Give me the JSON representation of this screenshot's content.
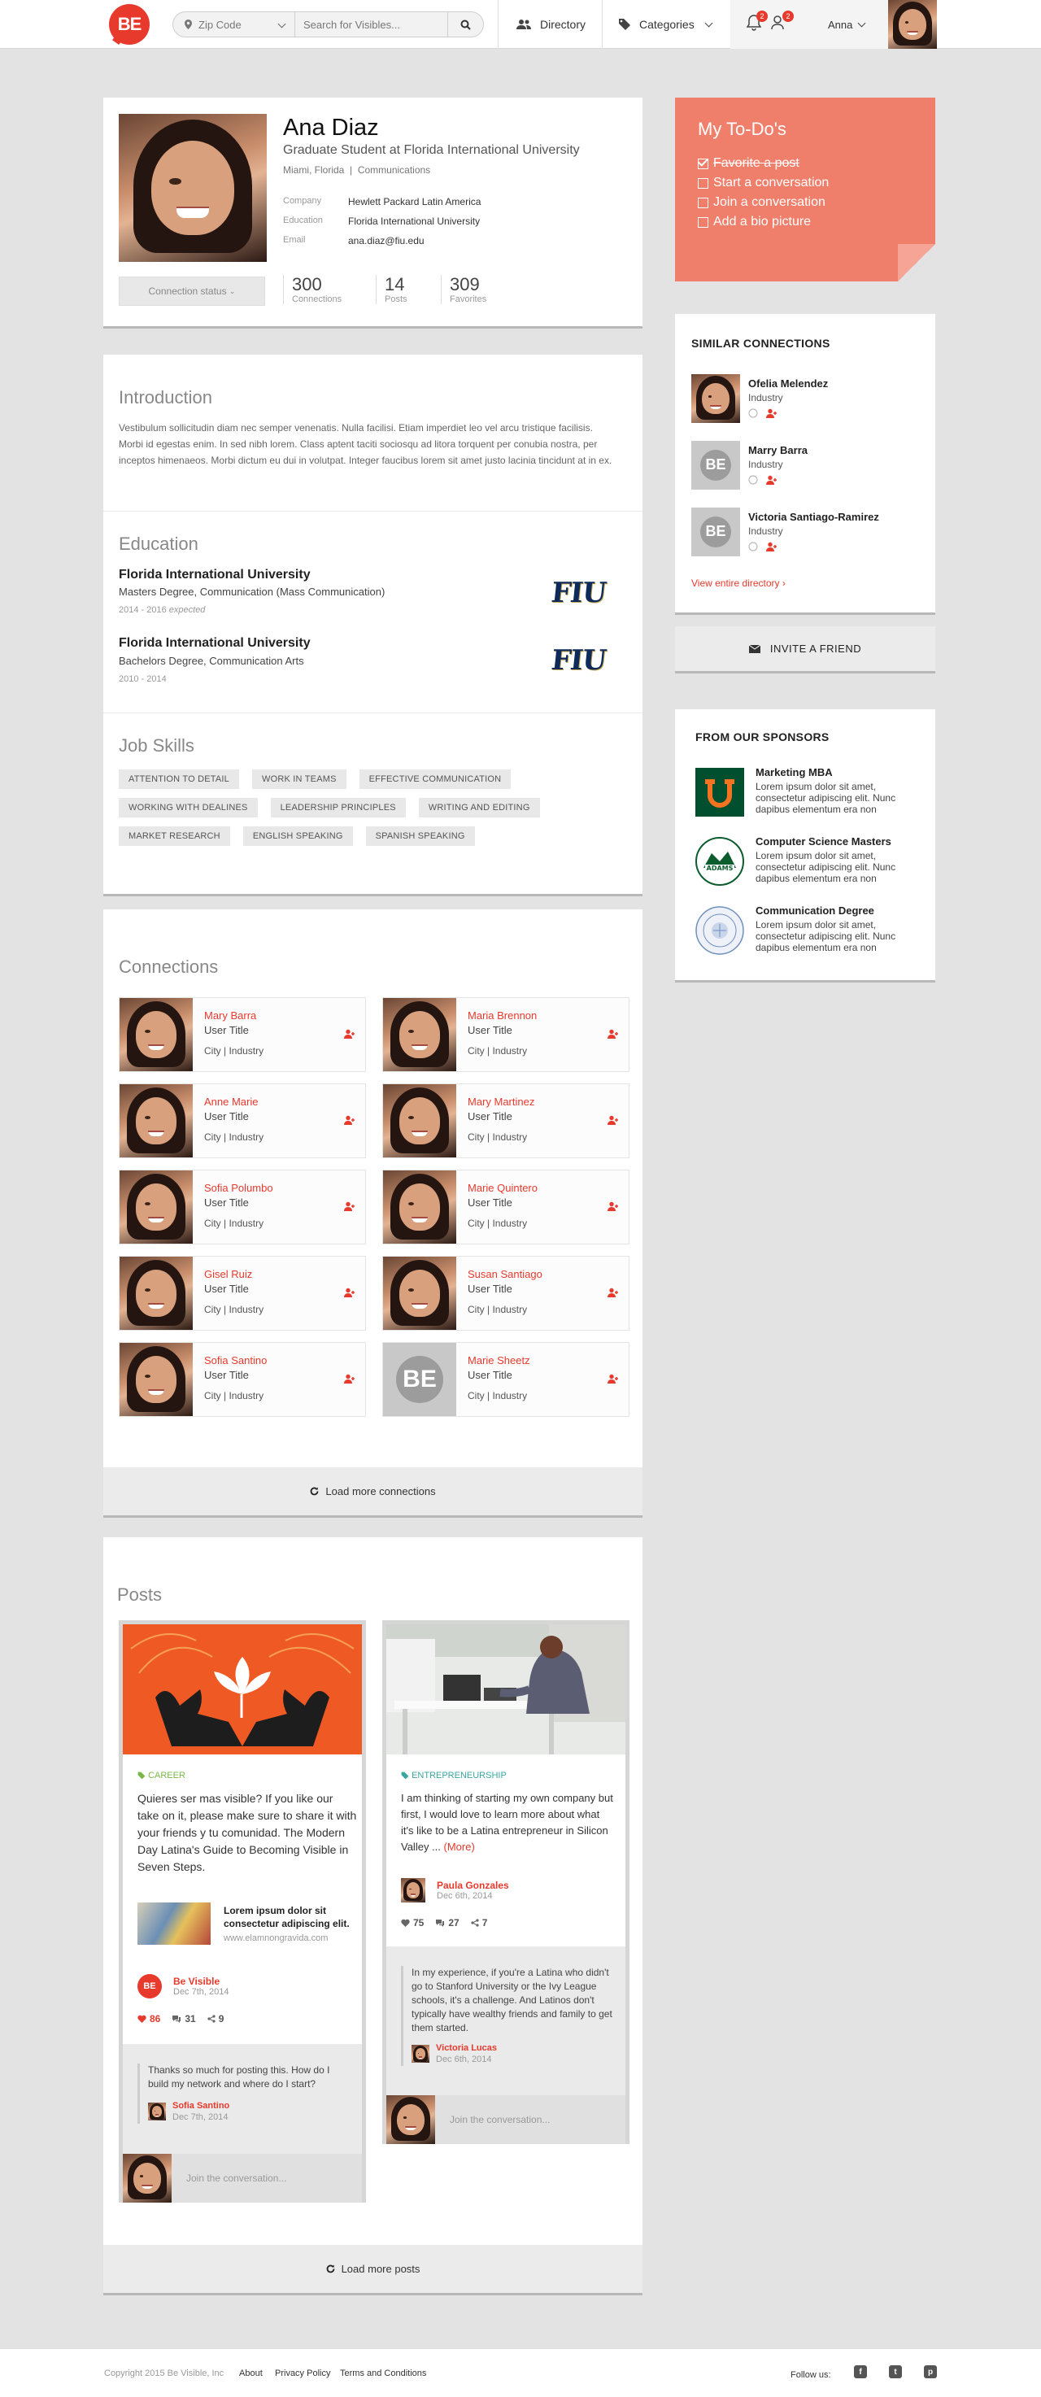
{
  "header": {
    "logo_text": "BE",
    "zip_label": "Zip Code",
    "search_placeholder": "Search for Visibles...",
    "nav_directory": "Directory",
    "nav_categories": "Categories",
    "notif_count": "2",
    "friend_count": "2",
    "user_name": "Anna"
  },
  "profile": {
    "name": "Ana Diaz",
    "title": "Graduate Student at Florida International University",
    "location": "Miami, Florida",
    "field": "Communications",
    "company_label": "Company",
    "company": "Hewlett Packard Latin America",
    "education_label": "Education",
    "education": "Florida International University",
    "email_label": "Email",
    "email": "ana.diaz@fiu.edu",
    "connection_status": "Connection status",
    "stats": [
      {
        "value": "300",
        "label": "Connections"
      },
      {
        "value": "14",
        "label": "Posts"
      },
      {
        "value": "309",
        "label": "Favorites"
      }
    ]
  },
  "intro": {
    "heading": "Introduction",
    "text": "Vestibulum sollicitudin diam nec semper venenatis. Nulla facilisi. Etiam imperdiet leo vel arcu tristique facilisis. Morbi id egestas enim. In sed nibh lorem. Class aptent taciti sociosqu ad litora torquent per conubia nostra, per inceptos himenaeos. Morbi dictum eu dui in volutpat. Integer faucibus lorem sit amet justo lacinia tincidunt at in ex."
  },
  "education": {
    "heading": "Education",
    "items": [
      {
        "school": "Florida International University",
        "degree": "Masters Degree, Communication (Mass Communication)",
        "years": "2014 - 2016",
        "note": "expected",
        "logo": "FIU"
      },
      {
        "school": "Florida International University",
        "degree": "Bachelors Degree, Communication Arts",
        "years": "2010 - 2014",
        "note": "",
        "logo": "FIU"
      }
    ]
  },
  "skills": {
    "heading": "Job Skills",
    "tags": [
      "ATTENTION TO DETAIL",
      "WORK IN TEAMS",
      "EFFECTIVE COMMUNICATION",
      "WORKING WITH DEALINES",
      "LEADERSHIP PRINCIPLES",
      "WRITING AND EDITING",
      "MARKET RESEARCH",
      "ENGLISH SPEAKING",
      "SPANISH SPEAKING"
    ]
  },
  "connections": {
    "heading": "Connections",
    "items": [
      {
        "name": "Mary Barra",
        "title": "User Title",
        "loc": "City | Industry"
      },
      {
        "name": "Maria Brennon",
        "title": "User Title",
        "loc": "City | Industry"
      },
      {
        "name": "Anne Marie",
        "title": "User Title",
        "loc": "City | Industry"
      },
      {
        "name": "Mary Martinez",
        "title": "User Title",
        "loc": "City | Industry"
      },
      {
        "name": "Sofia Polumbo",
        "title": "User Title",
        "loc": "City | Industry"
      },
      {
        "name": "Marie Quintero",
        "title": "User Title",
        "loc": "City | Industry"
      },
      {
        "name": "Gisel Ruiz",
        "title": "User Title",
        "loc": "City | Industry"
      },
      {
        "name": "Susan Santiago",
        "title": "User Title",
        "loc": "City | Industry"
      },
      {
        "name": "Sofia Santino",
        "title": "User Title",
        "loc": "City | Industry"
      },
      {
        "name": "Marie Sheetz",
        "title": "User Title",
        "loc": "City | Industry"
      }
    ],
    "load_more": "Load more connections"
  },
  "posts": {
    "heading": "Posts",
    "load_more": "Load more posts",
    "post1": {
      "category": "CAREER",
      "body": "Quieres ser mas visible? If you like our take on it, please make sure to share it with your friends y tu comunidad. The Modern Day Latina's Guide to Becoming Visible in Seven Steps.",
      "link_title": "Lorem ipsum dolor sit consectetur adipiscing elit.",
      "link_url": "www.elamnongravida.com",
      "author": "Be Visible",
      "date": "Dec 7th, 2014",
      "likes": "86",
      "comments": "31",
      "shares": "9",
      "comment_text": "Thanks so much for posting this. How do I build my network and where do I start?",
      "comment_author": "Sofia Santino",
      "comment_date": "Dec 7th, 2014",
      "join": "Join the conversation..."
    },
    "post2": {
      "category": "ENTREPRENEURSHIP",
      "body": "I am thinking of starting my own company but first, I would love to learn more about what it's like to be a Latina entrepreneur in Silicon Valley ...",
      "more": "(More)",
      "author": "Paula Gonzales",
      "date": "Dec 6th, 2014",
      "likes": "75",
      "comments": "27",
      "shares": "7",
      "comment_text": "In my experience, if you're a Latina who didn't go to Stanford University or the Ivy League schools, it's a challenge. And Latinos don't typically have wealthy friends and family to get them started.",
      "comment_author": "Victoria Lucas",
      "comment_date": "Dec 6th, 2014",
      "join": "Join the conversation..."
    }
  },
  "todo": {
    "heading": "My To-Do's",
    "items": [
      {
        "label": "Favorite a post",
        "done": true
      },
      {
        "label": "Start a conversation",
        "done": false
      },
      {
        "label": "Join a conversation",
        "done": false
      },
      {
        "label": "Add a bio picture",
        "done": false
      }
    ]
  },
  "similar": {
    "heading": "SIMILAR CONNECTIONS",
    "items": [
      {
        "name": "Ofelia Melendez",
        "industry": "Industry"
      },
      {
        "name": "Marry Barra",
        "industry": "Industry"
      },
      {
        "name": "Victoria Santiago-Ramirez",
        "industry": "Industry"
      }
    ],
    "view_all": "View entire directory"
  },
  "invite": {
    "label": "INVITE A FRIEND"
  },
  "sponsors": {
    "heading": "FROM OUR SPONSORS",
    "items": [
      {
        "title": "Marketing MBA",
        "desc": "Lorem ipsum dolor sit amet, consectetur adipiscing elit. Nunc dapibus elementum era non"
      },
      {
        "title": "Computer Science Masters",
        "desc": "Lorem ipsum dolor sit amet, consectetur adipiscing elit. Nunc dapibus elementum era non"
      },
      {
        "title": "Communication Degree",
        "desc": "Lorem ipsum dolor sit amet, consectetur adipiscing elit. Nunc dapibus elementum era non"
      }
    ]
  },
  "footer": {
    "copyright": "Copyright 2015 Be Visible, Inc",
    "about": "About",
    "privacy": "Privacy Policy",
    "terms": "Terms and Conditions",
    "follow": "Follow us:"
  },
  "colors": {
    "accent": "#e8392d",
    "todo_bg": "#ef7f6b",
    "career": "#7ab648",
    "entrepreneurship": "#3aa6a0"
  }
}
